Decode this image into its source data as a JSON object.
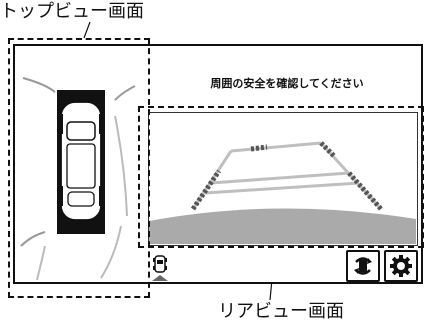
{
  "callouts": {
    "top_view": "トップビュー画面",
    "rear_view": "リアビュー画面"
  },
  "screen": {
    "message": "周囲の安全を確認してください"
  },
  "icons": {
    "camera_switch": "camera-switch-icon",
    "settings": "gear-icon",
    "vehicle": "car-icon"
  }
}
